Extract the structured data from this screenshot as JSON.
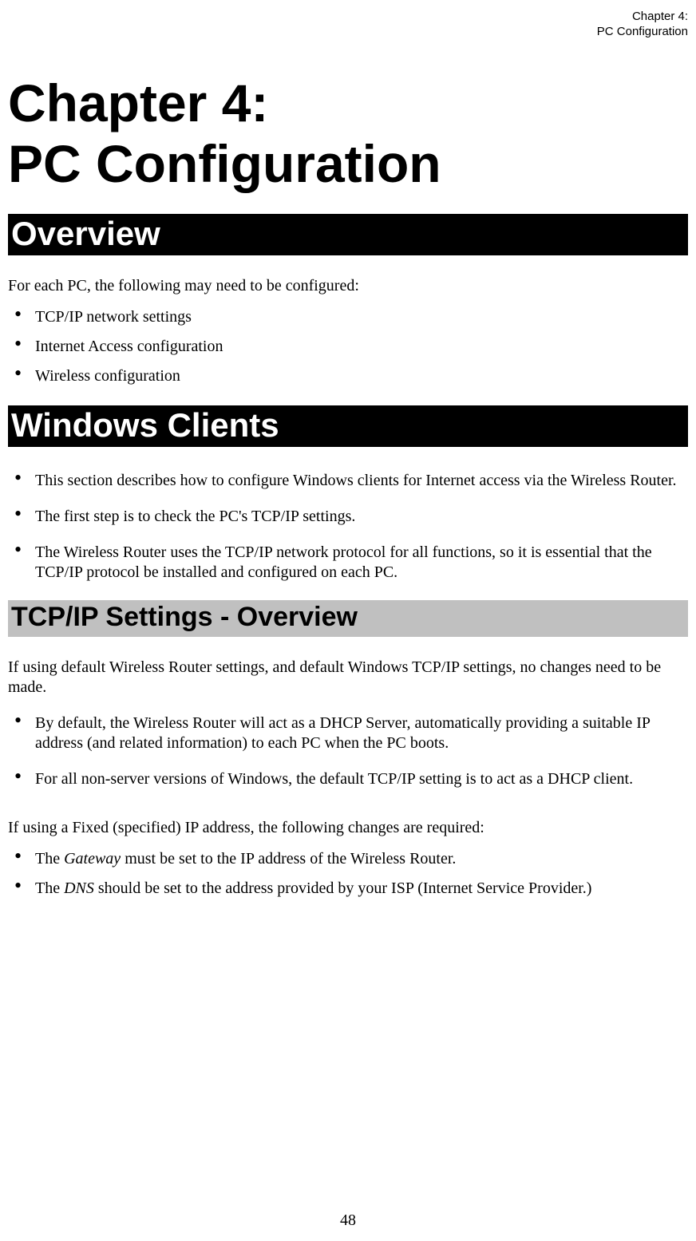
{
  "running_header": {
    "line1": "Chapter 4:",
    "line2": "PC Configuration"
  },
  "chapter_title": {
    "line1": "Chapter 4:",
    "line2": "PC Configuration"
  },
  "sections": {
    "overview": {
      "heading": "Overview",
      "intro": "For each PC, the following may need to be configured:",
      "bullets": [
        "TCP/IP network settings",
        "Internet Access configuration",
        "Wireless configuration"
      ]
    },
    "windows_clients": {
      "heading": "Windows Clients",
      "bullets": [
        "This section describes how to configure Windows clients for Internet access via the Wireless Router.",
        "The first step is to check the PC's TCP/IP settings.",
        "The Wireless Router uses the TCP/IP network protocol for all functions, so it is essential that the TCP/IP protocol be installed and configured on each PC."
      ]
    },
    "tcpip_settings": {
      "heading": "TCP/IP Settings - Overview",
      "intro": "If using default Wireless Router settings, and default Windows TCP/IP settings, no changes need to be made.",
      "bullets1": [
        "By default, the Wireless Router will act as a DHCP Server, automatically providing a suitable IP address (and related information) to each PC when the PC boots.",
        "For all non-server versions of Windows, the default TCP/IP setting is to act as a DHCP client."
      ],
      "intro2": "If using a Fixed (specified) IP address, the following changes are required:",
      "bullet_gateway_prefix": "The ",
      "bullet_gateway_em": "Gateway",
      "bullet_gateway_suffix": " must be set to the IP address of the Wireless Router.",
      "bullet_dns_prefix": "The ",
      "bullet_dns_em": "DNS",
      "bullet_dns_suffix": " should be set to the address provided by your ISP (Internet Service Provider.)"
    }
  },
  "page_number": "48"
}
